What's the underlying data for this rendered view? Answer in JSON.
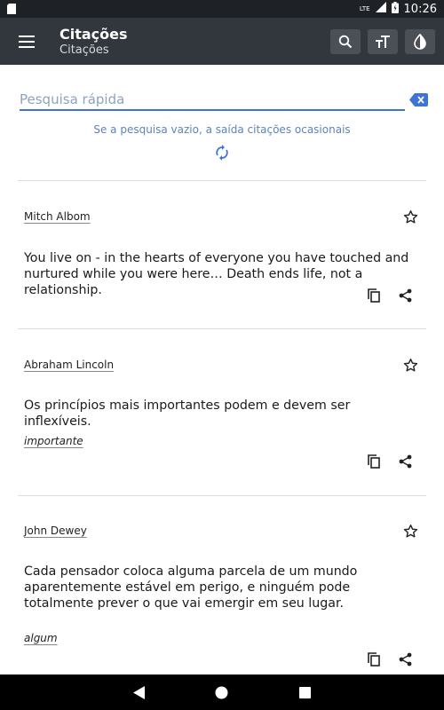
{
  "status": {
    "time": "10:26",
    "network": "LTE"
  },
  "appbar": {
    "title": "Citações",
    "subtitle": "Citações"
  },
  "search": {
    "placeholder": "Pesquisa rápida",
    "value": "",
    "hint": "Se a pesquisa vazio, a saída citações ocasionais"
  },
  "quotes": [
    {
      "author": "Mitch Albom",
      "text": "You live on - in the hearts of everyone you have touched and nurtured while you were here… Death ends life, not a relationship.",
      "tag": ""
    },
    {
      "author": "Abraham Lincoln",
      "text": "Os princípios mais importantes podem e devem ser inflexíveis.",
      "tag": "importante"
    },
    {
      "author": "John Dewey",
      "text": "Cada pensador coloca alguma parcela de um mundo aparentemente estável em perigo, e ninguém pode totalmente prever o que vai emergir em seu lugar.",
      "tag": "algum"
    }
  ],
  "colors": {
    "appbar": "#32373e",
    "statusbar": "#1e2126",
    "accent": "#3f74d6",
    "hint": "#5c84b7"
  },
  "icons": [
    "menu-icon",
    "search-icon",
    "text-size-icon",
    "contrast-icon",
    "clear-icon",
    "refresh-icon",
    "star-outline-icon",
    "copy-icon",
    "share-icon",
    "back-icon",
    "home-icon",
    "recents-icon"
  ]
}
